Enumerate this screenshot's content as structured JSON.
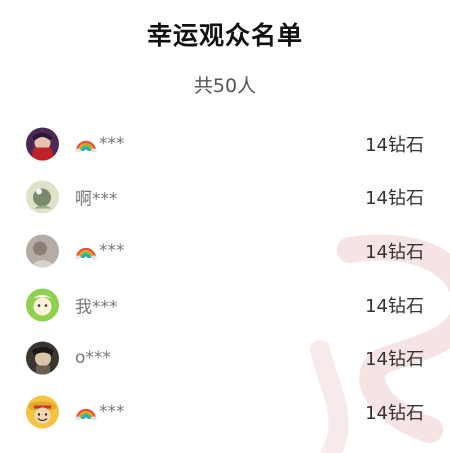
{
  "header": {
    "title": "幸运观众名单",
    "subtitle": "共50人"
  },
  "audience": [
    {
      "avatar_icon": "avatar-icon",
      "name_icon": "rainbow-icon",
      "name": "***",
      "diamonds": "14钻石"
    },
    {
      "avatar_icon": "avatar-icon",
      "name_icon": "",
      "name": "啊***",
      "diamonds": "14钻石"
    },
    {
      "avatar_icon": "avatar-icon",
      "name_icon": "rainbow-icon",
      "name": "***",
      "diamonds": "14钻石"
    },
    {
      "avatar_icon": "avatar-icon",
      "name_icon": "",
      "name": "我***",
      "diamonds": "14钻石"
    },
    {
      "avatar_icon": "avatar-icon",
      "name_icon": "",
      "name": "o***",
      "diamonds": "14钻石"
    },
    {
      "avatar_icon": "avatar-icon",
      "name_icon": "rainbow-icon",
      "name": "***",
      "diamonds": "14钻石"
    }
  ]
}
